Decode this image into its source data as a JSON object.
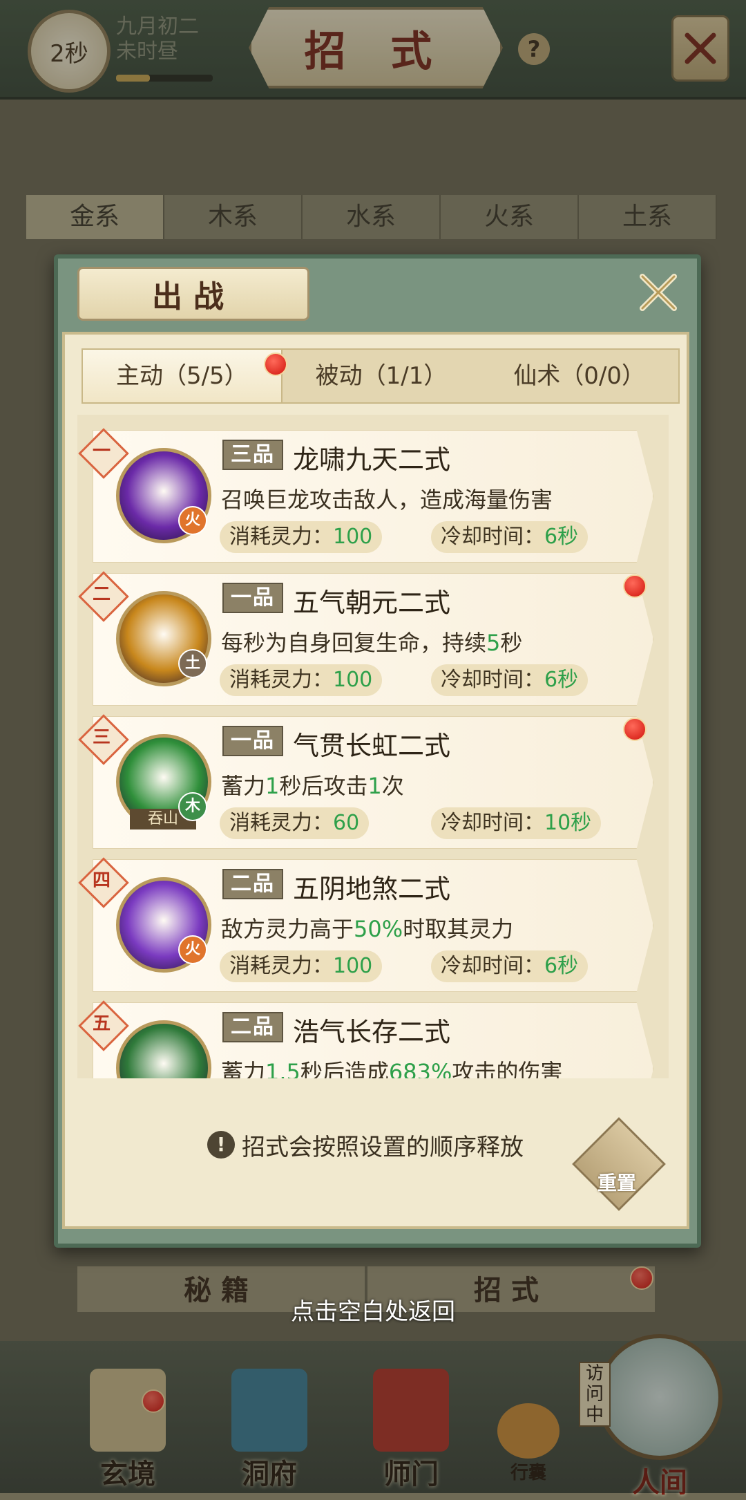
{
  "header": {
    "timer": "2秒",
    "date_line1": "九月初二",
    "date_line2": "未时昼",
    "time_progress": 0.35,
    "title": "招 式",
    "help_label": "?"
  },
  "element_tabs": [
    "金系",
    "木系",
    "水系",
    "火系",
    "土系"
  ],
  "panel": {
    "title": "出战",
    "subtabs": [
      {
        "label": "主动（5/5）",
        "active": true,
        "dot": true
      },
      {
        "label": "被动（1/1）",
        "active": false,
        "dot": false
      },
      {
        "label": "仙术（0/0）",
        "active": false,
        "dot": false
      }
    ],
    "skills": [
      {
        "order": "一",
        "grade": "三品",
        "name": "龙啸九天二式",
        "element": "火",
        "element_color": "#e0742c",
        "desc_parts": [
          {
            "t": "召唤巨龙攻击敌人，造成海量伤害",
            "g": false
          }
        ],
        "cost_label": "消耗灵力：",
        "cost_value": "100",
        "cd_label": "冷却时间：",
        "cd_value": "6秒",
        "icon": "dragon-skill-icon",
        "icon_color": "#6b2aa8",
        "dot": false
      },
      {
        "order": "二",
        "grade": "一品",
        "name": "五气朝元二式",
        "element": "土",
        "element_color": "#7d6a55",
        "desc_parts": [
          {
            "t": "每秒为自身回复生命，持续",
            "g": false
          },
          {
            "t": "5",
            "g": true
          },
          {
            "t": "秒",
            "g": false
          }
        ],
        "cost_label": "消耗灵力：",
        "cost_value": "100",
        "cd_label": "冷却时间：",
        "cd_value": "6秒",
        "icon": "monk-skill-icon",
        "icon_color": "#c8871c",
        "dot": true
      },
      {
        "order": "三",
        "grade": "一品",
        "name": "气贯长虹二式",
        "element": "木",
        "element_color": "#3d8f4a",
        "desc_parts": [
          {
            "t": "蓄力",
            "g": false
          },
          {
            "t": "1",
            "g": true
          },
          {
            "t": "秒后攻击",
            "g": false
          },
          {
            "t": "1",
            "g": true
          },
          {
            "t": "次",
            "g": false
          }
        ],
        "cost_label": "消耗灵力：",
        "cost_value": "60",
        "cd_label": "冷却时间：",
        "cd_value": "10秒",
        "icon": "heart-skill-icon",
        "icon_color": "#2f8f3a",
        "sub_label": "吞山",
        "dot": true
      },
      {
        "order": "四",
        "grade": "二品",
        "name": "五阴地煞二式",
        "element": "火",
        "element_color": "#e0742c",
        "desc_parts": [
          {
            "t": "敌方灵力高于",
            "g": false
          },
          {
            "t": "50%",
            "g": true
          },
          {
            "t": "时取其灵力",
            "g": false
          }
        ],
        "cost_label": "消耗灵力：",
        "cost_value": "100",
        "cd_label": "冷却时间：",
        "cd_value": "6秒",
        "icon": "vortex-skill-icon",
        "icon_color": "#7a3ac0",
        "dot": false
      },
      {
        "order": "五",
        "grade": "二品",
        "name": "浩气长存二式",
        "element": "",
        "element_color": "#3d8f4a",
        "desc_parts": [
          {
            "t": "蓄力",
            "g": false
          },
          {
            "t": "1.5",
            "g": true
          },
          {
            "t": "秒后造成",
            "g": false
          },
          {
            "t": "683%",
            "g": true
          },
          {
            "t": "攻击的伤害",
            "g": false
          }
        ],
        "cost_label": "",
        "cost_value": "",
        "cd_label": "",
        "cd_value": "",
        "icon": "sword-skill-icon",
        "icon_color": "#2f7a3a",
        "dot": false
      }
    ],
    "hint_icon": "!",
    "hint": "招式会按照设置的顺序释放",
    "reset_label": "重置"
  },
  "bottom_tabs": [
    "秘籍",
    "招式"
  ],
  "back_hint": "点击空白处返回",
  "nav": [
    {
      "label": "玄境",
      "icon": "scroll-icon"
    },
    {
      "label": "洞府",
      "icon": "pavilion-icon"
    },
    {
      "label": "师门",
      "icon": "banner-icon"
    },
    {
      "label": "行囊",
      "icon": "bag-icon"
    },
    {
      "label": "人间",
      "icon": "landscape-icon"
    }
  ],
  "visiting_label": "访问中",
  "colors": {
    "accent_green": "#2ea04a",
    "red_dot": "#d0140c",
    "title_red": "#7a2a1d"
  }
}
